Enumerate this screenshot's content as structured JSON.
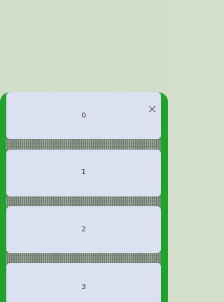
{
  "sheet": {
    "items": [
      {
        "label": "0"
      },
      {
        "label": "1"
      },
      {
        "label": "2"
      },
      {
        "label": "3"
      }
    ],
    "close_icon": "close-icon"
  },
  "colors": {
    "backdrop": "#d3dfcb",
    "sheet_accent": "#23a12f",
    "card": "#dbe1f0"
  }
}
